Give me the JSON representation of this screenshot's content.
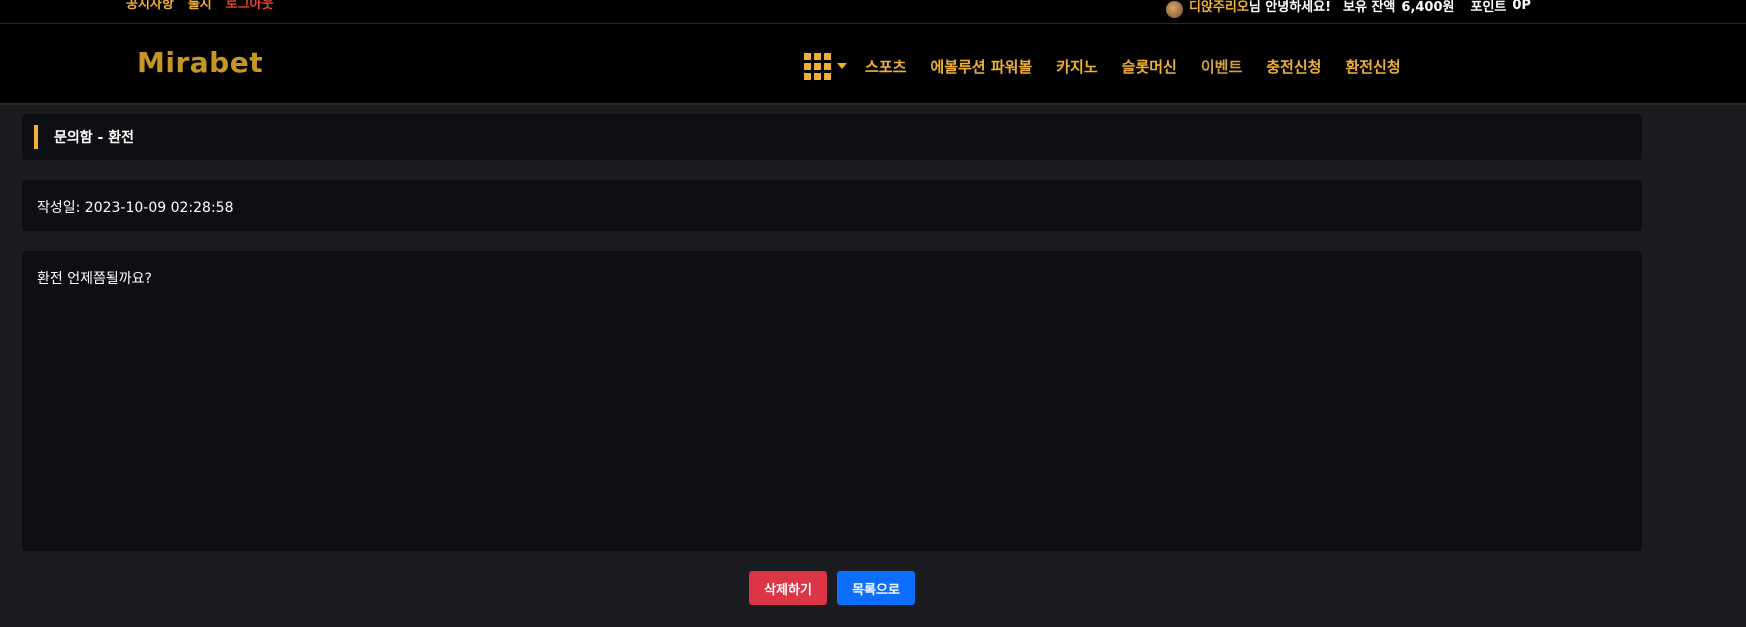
{
  "topbar": {
    "links": [
      "공지사항",
      "룰지"
    ],
    "logout": "로그아웃",
    "greeting_name": "디앉주리오",
    "greeting_suffix": "님 안녕하세요!",
    "balance_label": "보유 잔액",
    "balance_value": "6,400원",
    "points_label": "포인트",
    "points_value": "0P"
  },
  "header": {
    "logo": "Mirabet",
    "nav": [
      "스포츠",
      "에볼루션 파워볼",
      "카지노",
      "슬롯머신",
      "이벤트",
      "충전신청",
      "환전신청"
    ]
  },
  "inquiry": {
    "title": "문의함 - 환전",
    "date": "작성일: 2023-10-09 02:28:58",
    "content": "환전 언제쯤될까요?"
  },
  "buttons": {
    "delete": "삭제하기",
    "list": "목록으로"
  },
  "colors": {
    "accent": "#f0b132",
    "delete": "#dc3545",
    "list": "#0d6efd"
  }
}
